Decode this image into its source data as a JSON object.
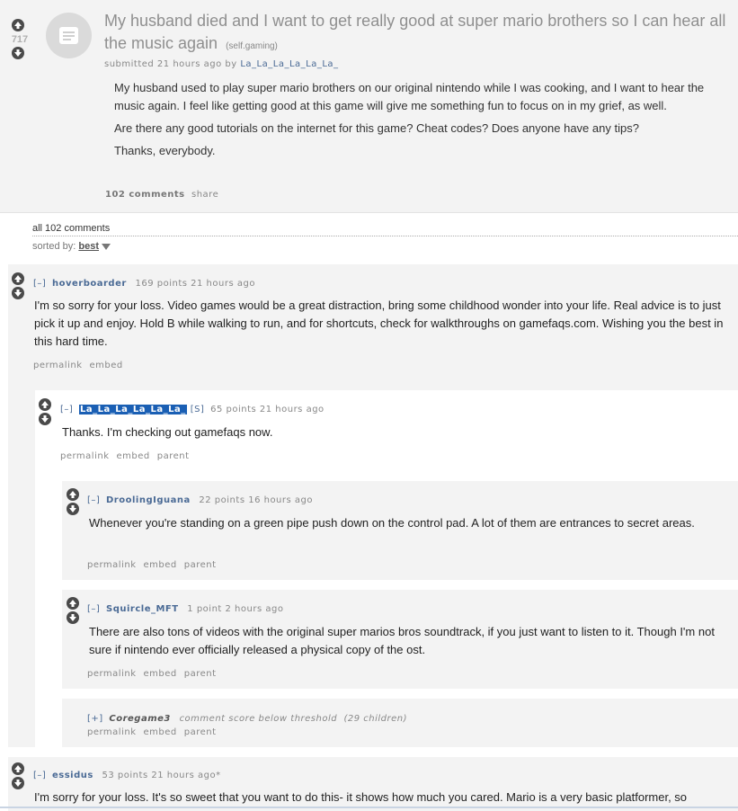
{
  "post": {
    "score": "717",
    "title": "My husband died and I want to get really good at super mario brothers so I can hear all the music again",
    "domain": "(self.gaming)",
    "submitted": "submitted 21 hours ago by",
    "author": "La_La_La_La_La_La_",
    "body": [
      "My husband used to play super mario brothers on our original nintendo while I was cooking, and I want to hear the music again. I feel like getting good at this game will give me something fun to focus on in my grief, as well.",
      "Are there any good tutorials on the internet for this game? Cheat codes? Does anyone have any tips?",
      "Thanks, everybody."
    ],
    "comments_link": "102 comments",
    "share": "share"
  },
  "comments_header": {
    "all": "all 102 comments",
    "sorted_label": "sorted by:",
    "sorted_value": "best"
  },
  "comments": [
    {
      "toggle": "[–]",
      "author": "hoverboarder",
      "meta": "169 points 21 hours ago",
      "body": "I'm so sorry for your loss. Video games would be a great distraction, bring some childhood wonder into your life. Real advice is to just pick it up and enjoy. Hold B while walking to run, and for shortcuts, check for walkthroughs on gamefaqs.com. Wishing you the best in this hard time.",
      "buttons": [
        "permalink",
        "embed"
      ]
    },
    {
      "toggle": "[–]",
      "author": "La_La_La_La_La_La_",
      "submitter_tag": "[S]",
      "meta": "65 points 21 hours ago",
      "body": "Thanks. I'm checking out gamefaqs now.",
      "buttons": [
        "permalink",
        "embed",
        "parent"
      ]
    },
    {
      "toggle": "[–]",
      "author": "DroolingIguana",
      "meta": "22 points 16 hours ago",
      "body": "Whenever you're standing on a green pipe push down on the control pad. A lot of them are entrances to secret areas.",
      "buttons": [
        "permalink",
        "embed",
        "parent"
      ]
    },
    {
      "toggle": "[–]",
      "author": "Squircle_MFT",
      "meta": "1 point 2 hours ago",
      "body": "There are also tons of videos with the original super marios bros soundtrack, if you just want to listen to it. Though I'm not sure if nintendo ever officially released a physical copy of the ost.",
      "buttons": [
        "permalink",
        "embed",
        "parent"
      ]
    },
    {
      "toggle": "[+]",
      "author": "Coregame3",
      "meta": "comment score below threshold",
      "children": "(29 children)",
      "buttons": [
        "permalink",
        "embed",
        "parent"
      ]
    },
    {
      "toggle": "[–]",
      "author": "essidus",
      "meta": "53 points 21 hours ago*",
      "body": "I'm sorry for your loss. It's so sweet that you want to do this- it shows how much you cared. Mario is a very basic platformer, so"
    }
  ],
  "icons": {
    "upvote": "arrow-up-circle-icon",
    "downvote": "arrow-down-circle-icon",
    "self_post": "self-post-icon",
    "sort_caret": "caret-down-icon"
  },
  "colors": {
    "link": "#4a6a95",
    "highlight": "#1a5fb4",
    "comment_bg": "#f3f3f3"
  }
}
